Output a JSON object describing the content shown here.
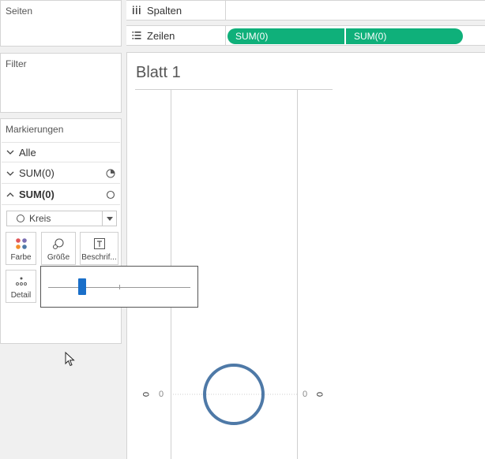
{
  "panels": {
    "pages_title": "Seiten",
    "filters_title": "Filter",
    "marks_title": "Markierungen"
  },
  "marks": {
    "rows": [
      {
        "label": "Alle",
        "expanded": false,
        "icon": "none"
      },
      {
        "label": "SUM(0)",
        "expanded": false,
        "icon": "pie-icon"
      },
      {
        "label": "SUM(0)",
        "expanded": true,
        "icon": "circle-icon"
      }
    ],
    "mark_type": "Kreis",
    "cards": [
      {
        "label": "Farbe",
        "icon": "color-dots-icon"
      },
      {
        "label": "Größe",
        "icon": "size-icon"
      },
      {
        "label": "Beschrif...",
        "icon": "text-label-icon"
      },
      {
        "label": "Detail",
        "icon": "detail-dots-icon"
      }
    ]
  },
  "size_popup": {
    "slider_value_fraction": 0.24
  },
  "shelves": {
    "columns_label": "Spalten",
    "rows_label": "Zeilen",
    "row_pills": [
      "SUM(0)",
      "SUM(0)"
    ],
    "pill_color": "#0fb07a"
  },
  "sheet": {
    "title": "Blatt 1",
    "left_axis_value": "0",
    "right_axis_value": "0",
    "left_axis_label": "0",
    "right_axis_label": "0",
    "mark_color": "#4e79a7"
  }
}
